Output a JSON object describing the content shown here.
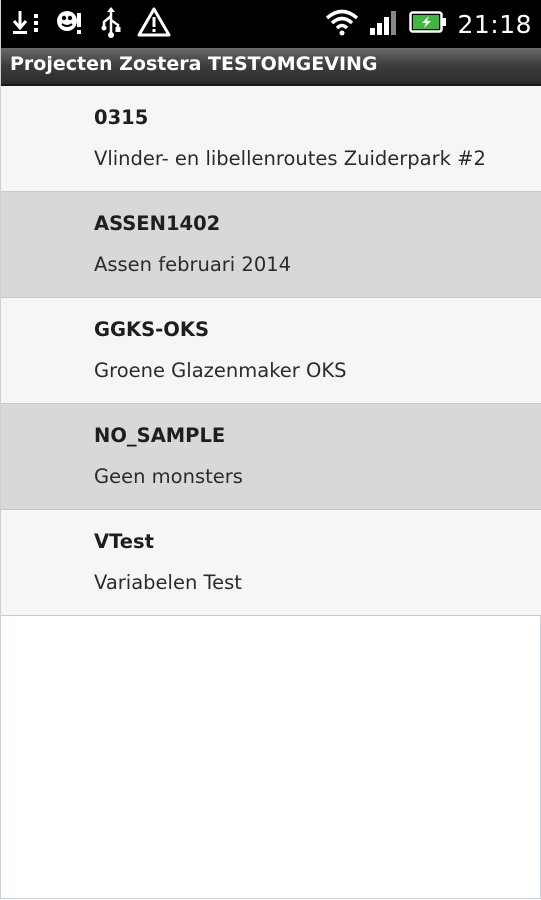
{
  "status_bar": {
    "time": "21:18",
    "icons_left": [
      "download-icon",
      "menu-dots-icon",
      "notification-icon",
      "usb-icon",
      "warning-icon"
    ],
    "icons_right": [
      "wifi-icon",
      "signal-icon",
      "battery-charging-icon"
    ]
  },
  "title_bar": {
    "title": "Projecten Zostera TESTOMGEVING"
  },
  "projects": [
    {
      "code": "0315",
      "description": "Vlinder- en libellenroutes Zuiderpark #2"
    },
    {
      "code": "ASSEN1402",
      "description": "Assen februari 2014"
    },
    {
      "code": "GGKS-OKS",
      "description": "Groene Glazenmaker OKS"
    },
    {
      "code": "NO_SAMPLE",
      "description": "Geen monsters"
    },
    {
      "code": "VTest",
      "description": "Variabelen Test"
    }
  ],
  "colors": {
    "row_light": "#f6f6f6",
    "row_dark": "#d8d8d8",
    "battery_accent": "#3fb83f"
  }
}
